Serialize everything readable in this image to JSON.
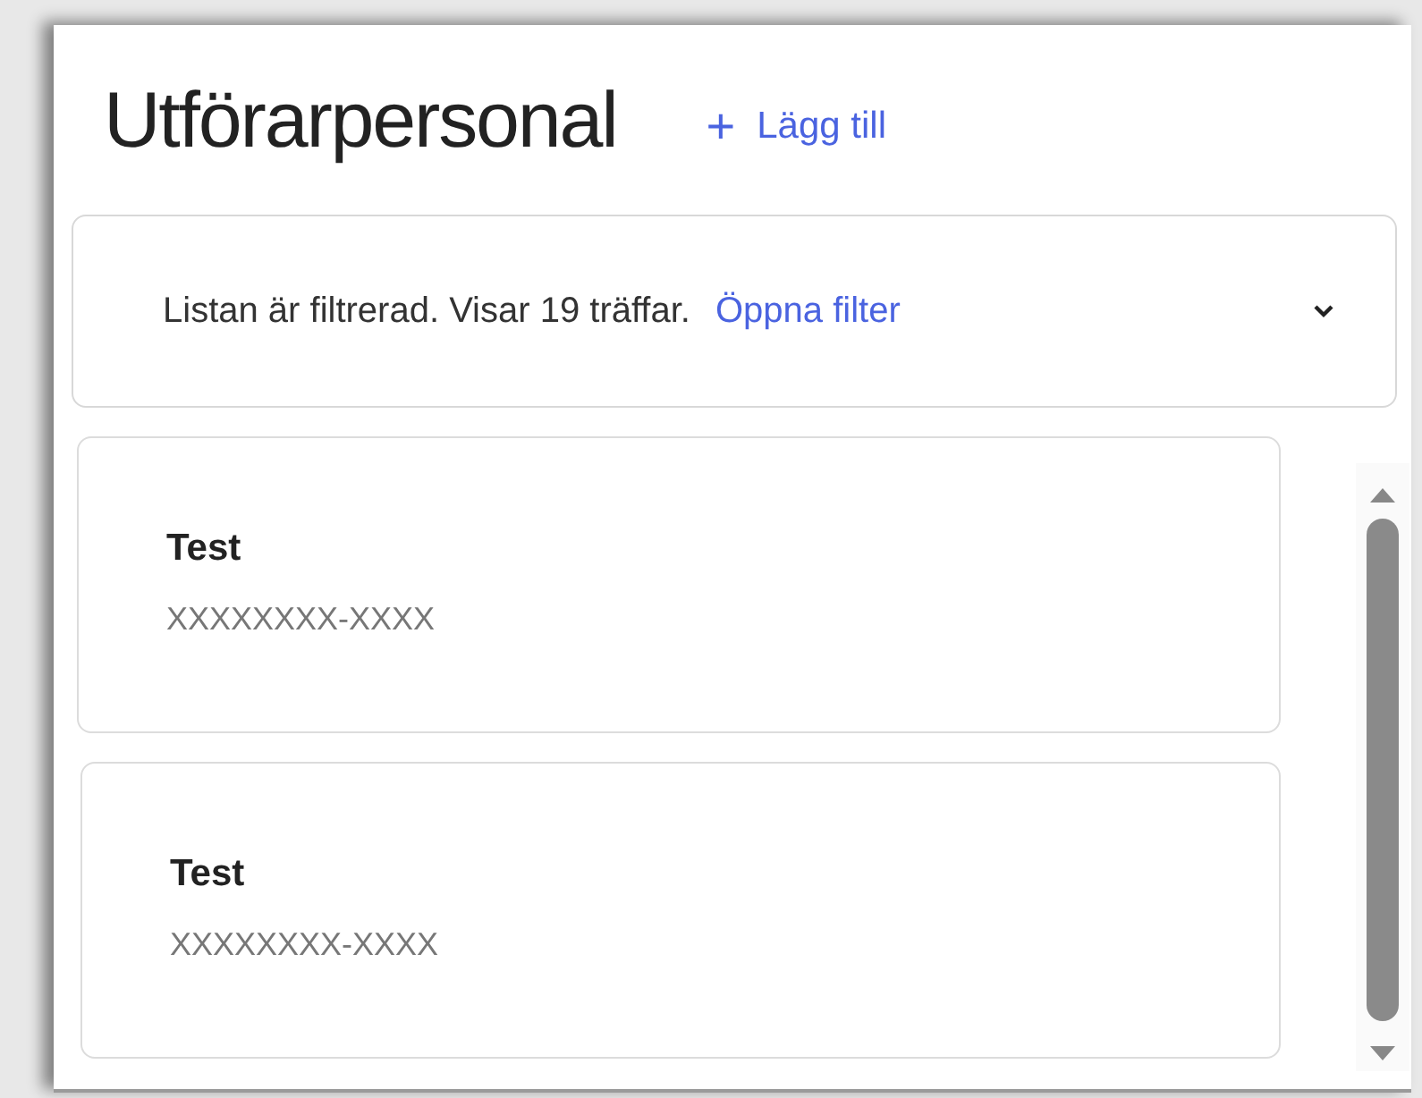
{
  "header": {
    "title": "Utförarpersonal",
    "add_button": {
      "icon": "+",
      "label": "Lägg till"
    }
  },
  "filter": {
    "message": "Listan är filtrerad. Visar 19 träffar.",
    "link": "Öppna filter",
    "expanded": false
  },
  "items": [
    {
      "name": "Test",
      "subtitle": "XXXXXXXX-XXXX"
    },
    {
      "name": "Test",
      "subtitle": "XXXXXXXX-XXXX"
    }
  ]
}
